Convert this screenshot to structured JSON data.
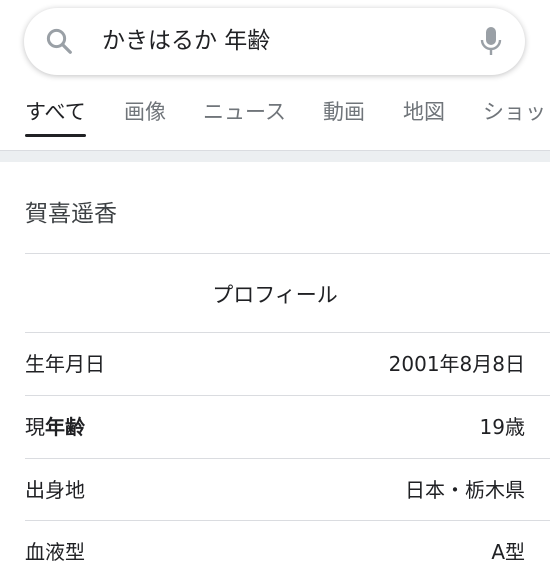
{
  "search": {
    "query": "かきはるか 年齢",
    "search_icon": "search-icon",
    "mic_icon": "microphone-icon"
  },
  "tabs": [
    {
      "label": "すべて",
      "active": true
    },
    {
      "label": "画像",
      "active": false
    },
    {
      "label": "ニュース",
      "active": false
    },
    {
      "label": "動画",
      "active": false
    },
    {
      "label": "地図",
      "active": false
    },
    {
      "label": "ショッ",
      "active": false
    }
  ],
  "entity": {
    "title": "賀喜遥香",
    "section_heading": "プロフィール",
    "rows": [
      {
        "label": "生年月日",
        "value": "2001年8月8日"
      },
      {
        "label_prefix": "現",
        "label_bold": "年齢",
        "value": "19歳"
      },
      {
        "label": "出身地",
        "value": "日本・栃木県"
      },
      {
        "label": "血液型",
        "value": "A型"
      }
    ]
  },
  "colors": {
    "text": "#202124",
    "muted": "#70757a",
    "divider": "#dadce0",
    "band": "#eceff1"
  }
}
